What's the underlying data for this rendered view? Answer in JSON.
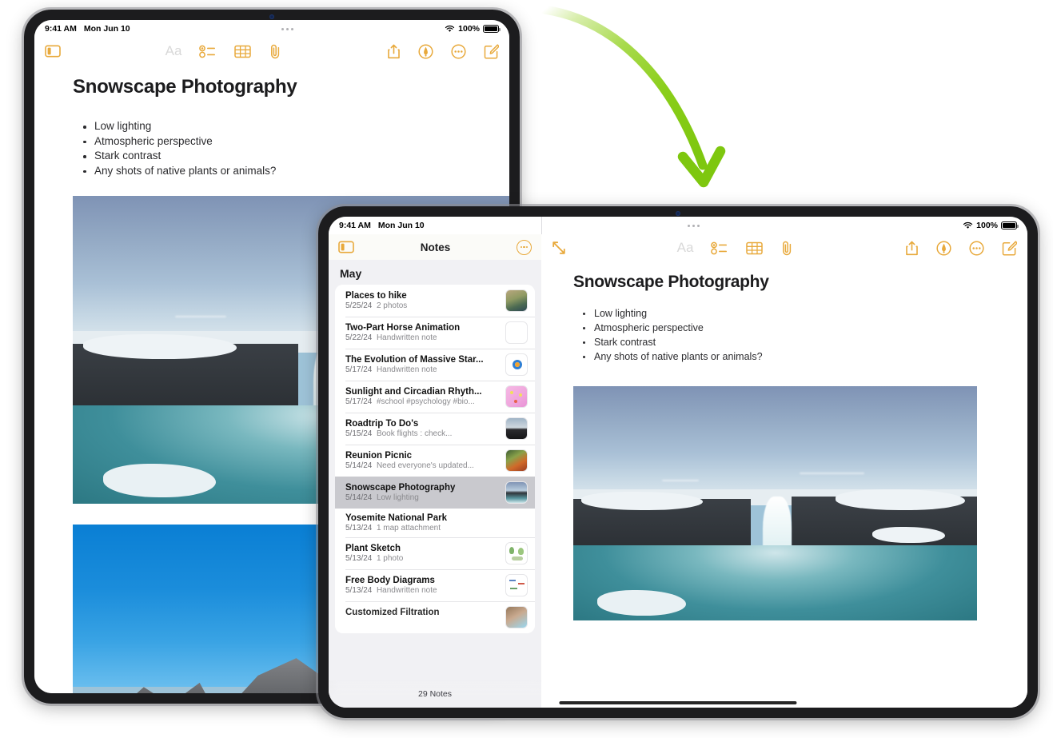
{
  "status_bar": {
    "time": "9:41 AM",
    "date": "Mon Jun 10",
    "battery_percent": "100%",
    "wifi_icon": "wifi-icon",
    "battery_icon": "battery-icon"
  },
  "toolbar": {
    "sidebar_toggle_icon": "sidebar-toggle-icon",
    "expand_icon": "expand-diagonal-icon",
    "format_label": "Aa",
    "checklist_icon": "checklist-icon",
    "table_icon": "table-icon",
    "attachment_icon": "paperclip-icon",
    "share_icon": "share-icon",
    "markup_icon": "markup-pen-icon",
    "more_icon": "more-ellipsis-icon",
    "compose_icon": "compose-icon"
  },
  "note": {
    "title": "Snowscape Photography",
    "bullets": [
      "Low lighting",
      "Atmospheric perspective",
      "Stark contrast",
      "Any shots of native plants or animals?"
    ],
    "photo_1_alt": "Frozen waterfall canyon with teal water",
    "photo_2_alt": "Snowy mountain peaks under bright blue sky"
  },
  "sidebar": {
    "app_title": "Notes",
    "more_button_icon": "more-ellipsis-circle-icon",
    "section_header": "May",
    "footer_count": "29 Notes",
    "items": [
      {
        "title": "Places to hike",
        "date": "5/25/24",
        "detail": "2 photos",
        "thumb": "hike",
        "selected": false
      },
      {
        "title": "Two-Part Horse Animation",
        "date": "5/22/24",
        "detail": "Handwritten note",
        "thumb": "blank",
        "selected": false
      },
      {
        "title": "The Evolution of Massive Star...",
        "date": "5/17/24",
        "detail": "Handwritten note",
        "thumb": "star",
        "selected": false
      },
      {
        "title": "Sunlight and Circadian Rhyth...",
        "date": "5/17/24",
        "detail": "#school #psychology #bio...",
        "thumb": "pink",
        "selected": false
      },
      {
        "title": "Roadtrip To Do's",
        "date": "5/15/24",
        "detail": "Book flights : check...",
        "thumb": "roadtrip",
        "selected": false
      },
      {
        "title": "Reunion Picnic",
        "date": "5/14/24",
        "detail": "Need everyone's updated...",
        "thumb": "picnic",
        "selected": false
      },
      {
        "title": "Snowscape Photography",
        "date": "5/14/24",
        "detail": "Low lighting",
        "thumb": "snow",
        "selected": true
      },
      {
        "title": "Yosemite National Park",
        "date": "5/13/24",
        "detail": "1 map attachment",
        "thumb": "none",
        "selected": false
      },
      {
        "title": "Plant Sketch",
        "date": "5/13/24",
        "detail": "1 photo",
        "thumb": "plant",
        "selected": false
      },
      {
        "title": "Free Body Diagrams",
        "date": "5/13/24",
        "detail": "Handwritten note",
        "thumb": "diagram",
        "selected": false
      },
      {
        "title": "Customized Filtration",
        "date": "",
        "detail": "",
        "thumb": "filtration",
        "selected": false
      }
    ]
  },
  "annotation": {
    "arrow_icon": "curved-green-arrow-icon",
    "arrow_color": "#8DCE17"
  },
  "colors": {
    "accent": "#E8A93B",
    "selected_row": "#C9C9CE",
    "list_background": "#F1F1F4",
    "nav_background": "#FBFBF8"
  }
}
